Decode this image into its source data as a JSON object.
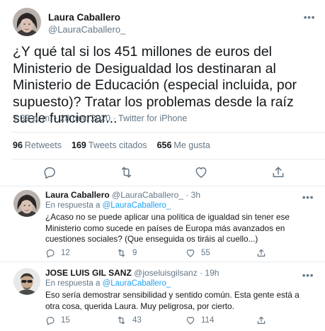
{
  "main_tweet": {
    "author_name": "Laura Caballero",
    "author_handle": "@LauraCaballero_",
    "text": "¿Y qué tal si los 451 millones de euros del Ministerio de Desigualdad los destinaran al Ministerio de Educación (especial incluida, por supuesto)? Tratar los problemas desde la raíz suele funcionar...",
    "time": "7:33 p. m.",
    "date": "28 nov. 2020",
    "separator": "·",
    "source": "Twitter for iPhone",
    "stats": {
      "retweets_count": "96",
      "retweets_label": "Retweets",
      "quotes_count": "169",
      "quotes_label": "Tweets citados",
      "likes_count": "656",
      "likes_label": "Me gusta"
    },
    "more_glyph": "•••"
  },
  "replies": [
    {
      "author_name": "Laura Caballero",
      "author_handle": "@LauraCaballero_",
      "age": "3h",
      "separator": "·",
      "in_reply_prefix": "En respuesta a",
      "in_reply_to": "@LauraCaballero_",
      "text": "¿Acaso no se puede aplicar una política de igualdad sin tener ese Ministerio como sucede en países de Europa más avanzados en cuestiones sociales? (Que enseguida os tiráis al cuello...)",
      "reply_count": "12",
      "retweet_count": "9",
      "like_count": "55"
    },
    {
      "author_name": "JOSE LUIS GIL SANZ",
      "author_handle": "@joseluisgilsanz",
      "age": "19h",
      "separator": "·",
      "in_reply_prefix": "En respuesta a",
      "in_reply_to": "@LauraCaballero_",
      "text": "Eso sería demostrar sensibilidad y sentido común. Esta gente está a otra cosa, querida Laura. Muy peligrosa, por cierto.",
      "reply_count": "15",
      "retweet_count": "43",
      "like_count": "114"
    }
  ],
  "icons": [
    "reply-icon",
    "retweet-icon",
    "like-icon",
    "share-icon",
    "more-icon"
  ],
  "colors": {
    "text": "#14171a",
    "secondary": "#657786",
    "link": "#1da1f2",
    "divider": "#e6ecf0"
  }
}
